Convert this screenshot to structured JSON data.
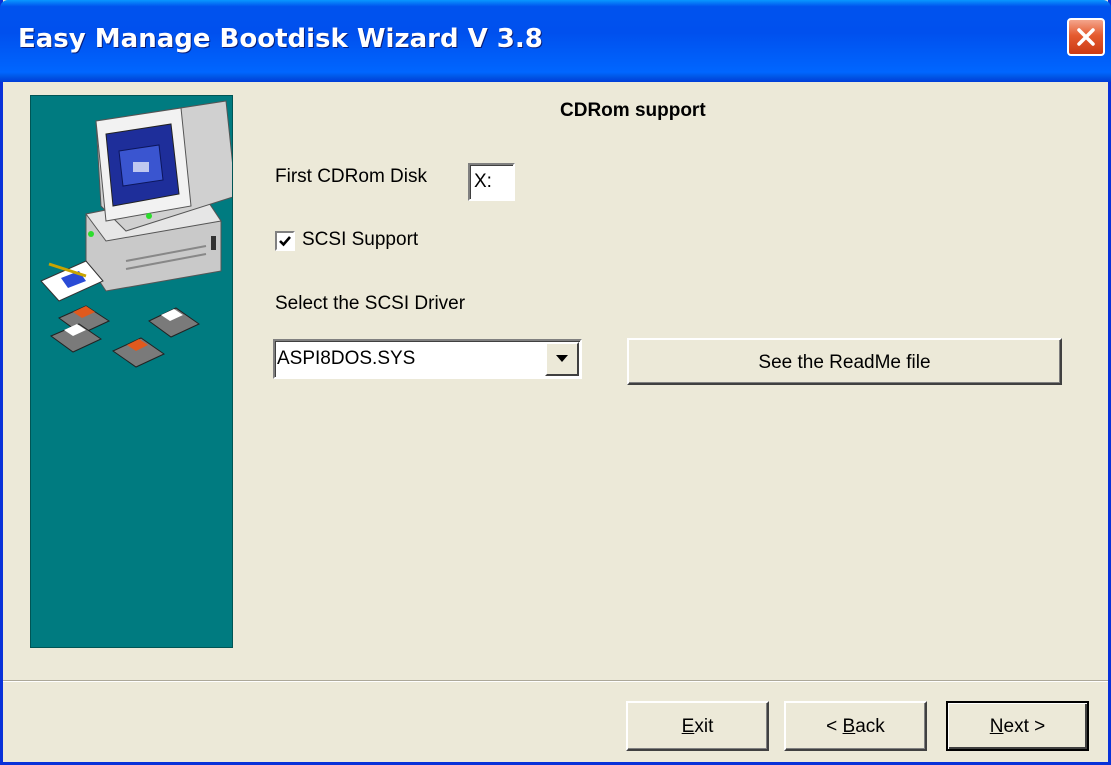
{
  "window": {
    "title": "Easy Manage Bootdisk Wizard V 3.8",
    "close_icon": "close-icon"
  },
  "colors": {
    "titlebar": "#0054E3",
    "sidebar": "#007B80",
    "face": "#ECE9D8",
    "close": "#E55B2F"
  },
  "sidebar": {
    "illustration": "computer-floppy-disks-illustration"
  },
  "page": {
    "heading": "CDRom support"
  },
  "cdrom": {
    "label": "First CDRom Disk",
    "value": "X:"
  },
  "scsi": {
    "label": "SCSI Support",
    "checked": true
  },
  "driver": {
    "label": "Select the SCSI Driver",
    "selected": "ASPI8DOS.SYS",
    "readme_button": "See the ReadMe file"
  },
  "footer": {
    "exit": {
      "pre": "",
      "accel": "E",
      "post": "xit"
    },
    "back": {
      "pre": "< ",
      "accel": "B",
      "post": "ack"
    },
    "next": {
      "pre": "",
      "accel": "N",
      "post": "ext >"
    }
  }
}
